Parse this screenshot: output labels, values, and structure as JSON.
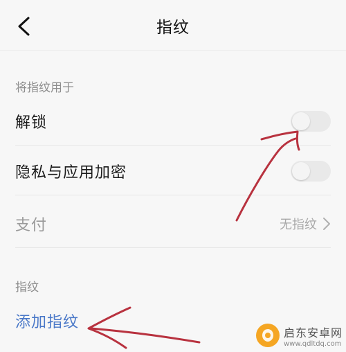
{
  "header": {
    "title": "指纹",
    "back_icon": "chevron-left-icon"
  },
  "sections": [
    {
      "label": "将指纹用于",
      "rows": [
        {
          "label": "解锁",
          "control": "toggle",
          "enabled": false
        },
        {
          "label": "隐私与应用加密",
          "control": "toggle",
          "enabled": false
        },
        {
          "label": "支付",
          "control": "link",
          "value": "无指纹",
          "icon": "chevron-right-icon"
        }
      ]
    },
    {
      "label": "指纹",
      "rows": [
        {
          "label": "添加指纹",
          "control": "action"
        }
      ]
    }
  ],
  "watermark": {
    "name": "启东安卓网",
    "url": "www.qdltdq.com"
  },
  "colors": {
    "background": "#f7f7f7",
    "link": "#4a78c8",
    "annotation": "#b8323f",
    "watermark_logo": "#f5a623"
  }
}
